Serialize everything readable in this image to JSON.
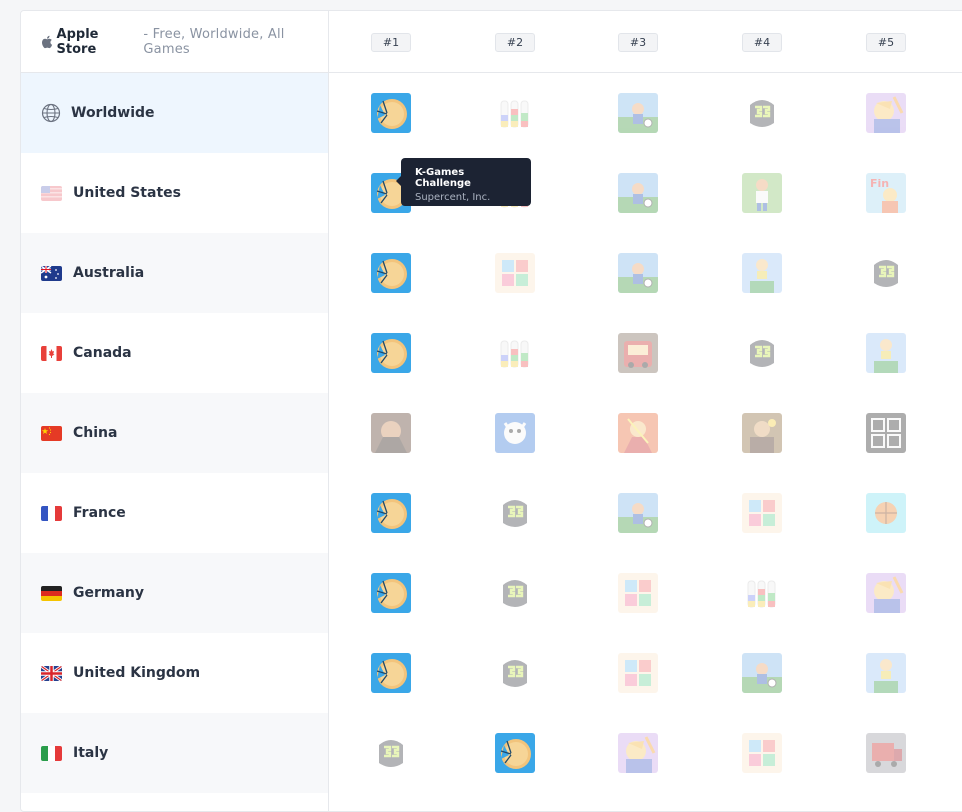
{
  "header": {
    "store_name": "Apple Store",
    "store_filters": "- Free, Worldwide, All Games"
  },
  "ranks": [
    "#1",
    "#2",
    "#3",
    "#4",
    "#5"
  ],
  "countries": [
    {
      "name": "Worldwide",
      "icon": "globe-icon"
    },
    {
      "name": "United States",
      "icon": "flag-us-icon"
    },
    {
      "name": "Australia",
      "icon": "flag-au-icon"
    },
    {
      "name": "Canada",
      "icon": "flag-ca-icon"
    },
    {
      "name": "China",
      "icon": "flag-cn-icon"
    },
    {
      "name": "France",
      "icon": "flag-fr-icon"
    },
    {
      "name": "Germany",
      "icon": "flag-de-icon"
    },
    {
      "name": "United Kingdom",
      "icon": "flag-gb-icon"
    },
    {
      "name": "Italy",
      "icon": "flag-it-icon"
    }
  ],
  "tooltip": {
    "title": "K-Games Challenge",
    "publisher": "Supercent, Inc."
  },
  "colors": {
    "accent_blue": "#3aa7e8",
    "selected_row": "#eef6fe",
    "tooltip_bg": "#1c2333"
  }
}
